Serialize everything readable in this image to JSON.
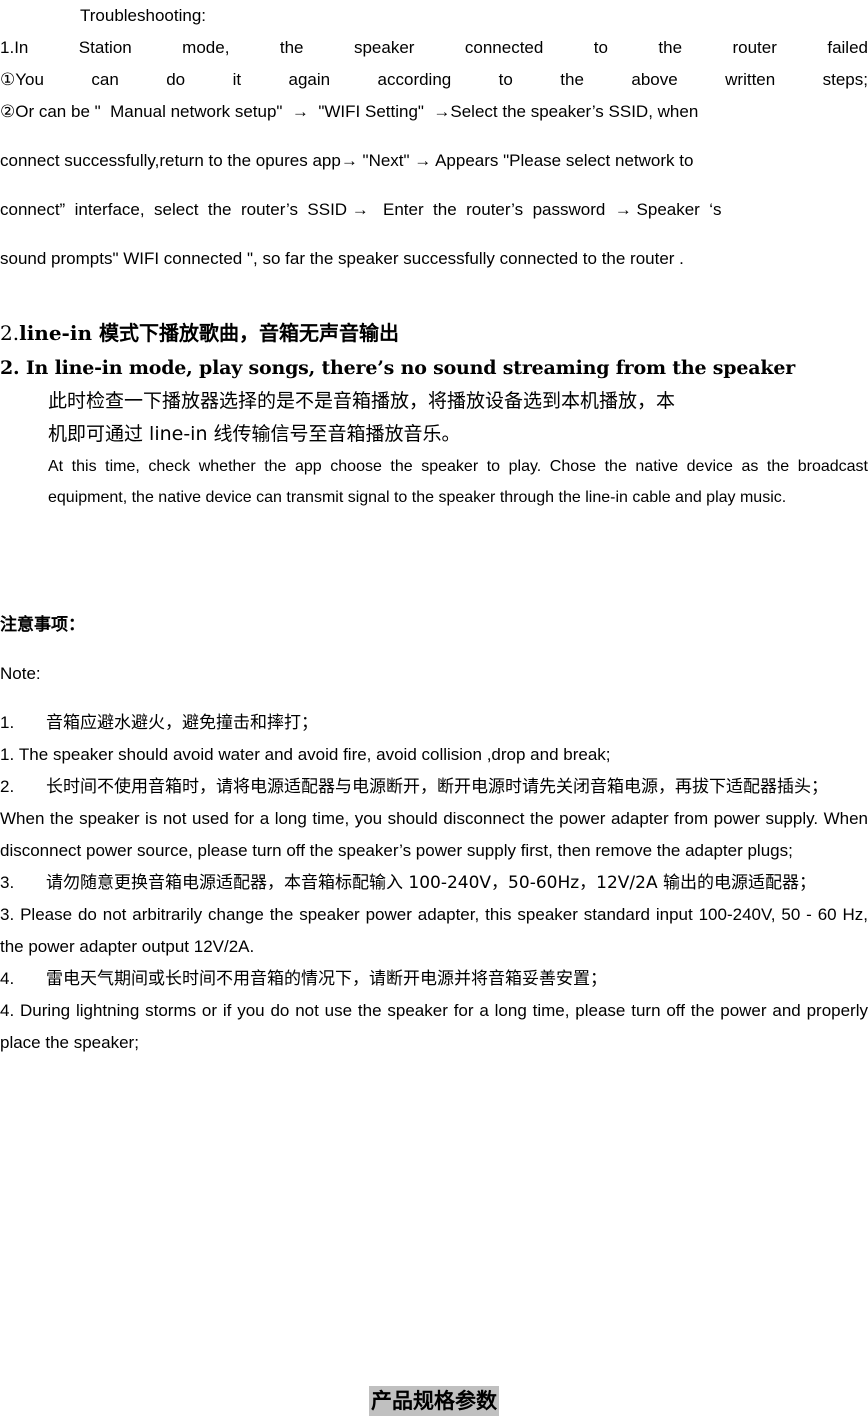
{
  "document": {
    "language_note": "bilingual Chinese / English product manual page",
    "background_color": "#ffffff",
    "text_color": "#000000",
    "highlight_color": "#c0c0c0"
  },
  "troubleshooting": {
    "heading": "Troubleshooting:",
    "item1": {
      "marker": "1.",
      "text": "In Station mode, the speaker connected to the router failed"
    },
    "sub1": {
      "marker": "①",
      "text": "You can do it again according to the above written steps;"
    },
    "sub2": {
      "marker": "②",
      "line1": "Or can be \"  Manual network setup\"  →  \"WIFI Setting\"  →Select the speaker’s SSID, when",
      "line2": "connect successfully,return to the opures app→ \"Next\" → Appears \"Please select network to",
      "line3": "connect”  interface,  select  the  router’s  SSID →   Enter  the  router’s  password  → Speaker  ‘s",
      "line4": "sound prompts\" WIFI connected \", so far the speaker successfully connected to the router ."
    }
  },
  "section2": {
    "title_cn_marker": "2.",
    "title_cn": "line-in 模式下播放歌曲，音箱无声音输出",
    "title_en": "2. In line-in mode, play songs, there’s no sound streaming from the speaker",
    "body_cn_line1": "此时检查一下播放器选择的是不是音箱播放，将播放设备选到本机播放，本",
    "body_cn_line2": "机即可通过 line-in 线传输信号至音箱播放音乐。",
    "body_en": "At this time, check whether the app choose the speaker to play. Chose the native device as the broadcast equipment, the native device can transmit signal to the speaker through the line-in cable and play music."
  },
  "notes": {
    "heading_cn": "注意事项：",
    "heading_en": "Note:",
    "items": [
      {
        "marker": "1.",
        "cn": "音箱应避水避火，避免撞击和摔打；",
        "en_marker": "1.",
        "en": "The speaker should avoid water and avoid fire, avoid collision ,drop and break;"
      },
      {
        "marker": "2.",
        "cn": "长时间不使用音箱时，请将电源适配器与电源断开，断开电源时请先关闭音箱电源，再拔下适配器插头；",
        "en_marker": "",
        "en": "When the speaker is not used for a long time, you should disconnect the power adapter from power supply. When disconnect power source, please turn off the speaker’s power supply first, then remove the adapter plugs;"
      },
      {
        "marker": "3.",
        "cn": "请勿随意更换音箱电源适配器，本音箱标配输入 100-240V，50-60Hz，12V/2A 输出的电源适配器；",
        "en_marker": "3.",
        "en": "Please do not arbitrarily change the speaker power adapter, this speaker standard input 100-240V, 50 - 60 Hz, the power adapter output 12V/2A."
      },
      {
        "marker": "4.",
        "cn": "雷电天气期间或长时间不用音箱的情况下，请断开电源并将音箱妥善安置；",
        "en_marker": "4.",
        "en": "During lightning storms or if you do not use the speaker for a long time, please turn off the power and properly place the speaker;"
      }
    ]
  },
  "footer": {
    "heading": "产品规格参数"
  }
}
